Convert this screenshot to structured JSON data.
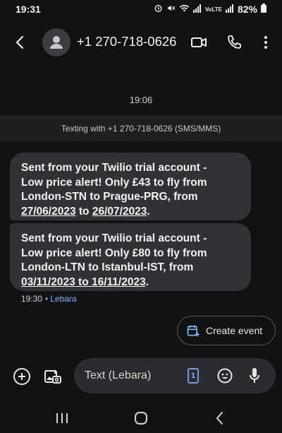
{
  "status_bar": {
    "time": "19:31",
    "network": "VoLTE",
    "battery": "82%"
  },
  "header": {
    "contact": "+1 270-718-0626"
  },
  "thread": {
    "date_separator": "19:06",
    "banner": "Texting with +1 270-718-0626 (SMS/MMS)",
    "messages": [
      {
        "line1": "Sent from your Twilio trial account -",
        "line2": "Low price alert! Only £43 to fly from",
        "line3": "London-STN to Prague-PRG, from",
        "date_from": "27/06/2023",
        "to_word": "to",
        "date_to": "26/07/2023",
        "end": "."
      },
      {
        "line1": "Sent from your Twilio trial account -",
        "line2": "Low price alert! Only £80 to fly from",
        "line3": "London-LTN to Istanbul-IST, from",
        "date_from": "03/11/2023",
        "to_word": "to",
        "date_to": "16/11/2023",
        "end": "."
      }
    ],
    "meta_time": "19:30",
    "meta_sim": "Lebara"
  },
  "suggestion": {
    "label": "Create event"
  },
  "compose": {
    "placeholder": "Text (Lebara)",
    "sim_number": "1"
  },
  "colors": {
    "background": "#111214",
    "bubble": "#303236",
    "accent": "#8ab4f8"
  }
}
